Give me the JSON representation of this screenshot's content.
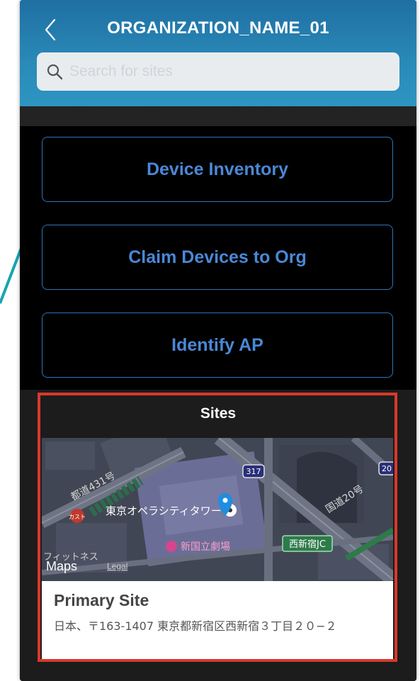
{
  "header": {
    "title": "ORGANIZATION_NAME_01",
    "back_icon": "chevron-left-icon"
  },
  "search": {
    "placeholder": "Search for sites",
    "value": "",
    "icon": "search-icon"
  },
  "actions": [
    {
      "label": "Device Inventory"
    },
    {
      "label": "Claim Devices to Org"
    },
    {
      "label": "Identify AP"
    }
  ],
  "sites": {
    "heading": "Sites",
    "items": [
      {
        "name": "Primary Site",
        "address": "日本、〒163-1407 東京都新宿区西新宿３丁目２０−２",
        "map": {
          "attribution": "Maps",
          "legal": "Legal",
          "labels": [
            "東京オペラシティタワー",
            "新国立劇場",
            "西新宿JC",
            "国道20号",
            "都道431号",
            "317",
            "20",
            "カスト",
            "フィットネス"
          ]
        }
      }
    ]
  },
  "colors": {
    "header_top": "#1f6fa3",
    "header_bottom": "#2d95c2",
    "button_border": "#2f73b8",
    "button_text": "#4a88d6",
    "highlight": "#d9382c",
    "annotation": "#1aa3b3"
  }
}
